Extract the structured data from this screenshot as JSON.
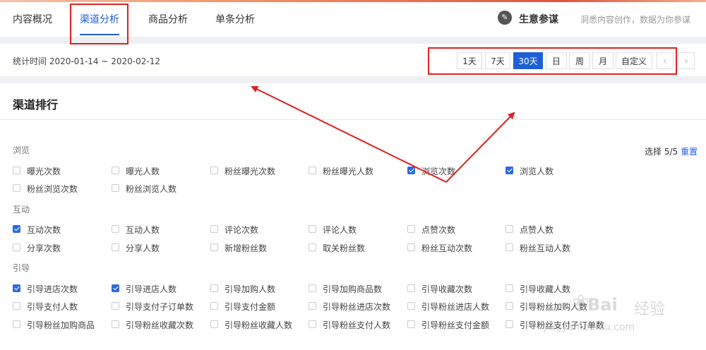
{
  "nav": {
    "tabs": [
      {
        "label": "内容概况"
      },
      {
        "label": "渠道分析"
      },
      {
        "label": "商品分析"
      },
      {
        "label": "单条分析"
      }
    ],
    "brand_name": "生意参谋",
    "brand_slogan": "洞悉内容创作，数据为你参谋"
  },
  "stats": {
    "time_text": "统计时间 2020-01-14 ~ 2020-02-12",
    "buttons": [
      {
        "label": "1天"
      },
      {
        "label": "7天"
      },
      {
        "label": "30天"
      },
      {
        "label": "日"
      },
      {
        "label": "周"
      },
      {
        "label": "月"
      },
      {
        "label": "自定义"
      },
      {
        "label": "‹"
      },
      {
        "label": "›"
      }
    ]
  },
  "ranking": {
    "title": "渠道排行",
    "select_text": "选择 5/5",
    "reset_label": "重置",
    "groups": [
      {
        "label": "浏览",
        "items": [
          {
            "label": "曝光次数",
            "checked": false
          },
          {
            "label": "曝光人数",
            "checked": false
          },
          {
            "label": "粉丝曝光次数",
            "checked": false
          },
          {
            "label": "粉丝曝光人数",
            "checked": false
          },
          {
            "label": "浏览次数",
            "checked": true
          },
          {
            "label": "浏览人数",
            "checked": true
          },
          {
            "label": "粉丝浏览次数",
            "checked": false
          },
          {
            "label": "粉丝浏览人数",
            "checked": false
          }
        ]
      },
      {
        "label": "互动",
        "items": [
          {
            "label": "互动次数",
            "checked": true
          },
          {
            "label": "互动人数",
            "checked": false
          },
          {
            "label": "评论次数",
            "checked": false
          },
          {
            "label": "评论人数",
            "checked": false
          },
          {
            "label": "点赞次数",
            "checked": false
          },
          {
            "label": "点赞人数",
            "checked": false
          },
          {
            "label": "分享次数",
            "checked": false
          },
          {
            "label": "分享人数",
            "checked": false
          },
          {
            "label": "新增粉丝数",
            "checked": false
          },
          {
            "label": "取关粉丝数",
            "checked": false
          },
          {
            "label": "粉丝互动次数",
            "checked": false
          },
          {
            "label": "粉丝互动人数",
            "checked": false
          }
        ]
      },
      {
        "label": "引导",
        "items": [
          {
            "label": "引导进店次数",
            "checked": true
          },
          {
            "label": "引导进店人数",
            "checked": true
          },
          {
            "label": "引导加购人数",
            "checked": false
          },
          {
            "label": "引导加购商品数",
            "checked": false
          },
          {
            "label": "引导收藏次数",
            "checked": false
          },
          {
            "label": "引导收藏人数",
            "checked": false
          },
          {
            "label": "引导支付人数",
            "checked": false
          },
          {
            "label": "引导支付子订单数",
            "checked": false
          },
          {
            "label": "引导支付金额",
            "checked": false
          },
          {
            "label": "引导粉丝进店次数",
            "checked": false
          },
          {
            "label": "引导粉丝进店人数",
            "checked": false
          },
          {
            "label": "引导粉丝加购人数",
            "checked": false
          },
          {
            "label": "引导粉丝加购商品",
            "checked": false
          },
          {
            "label": "引导粉丝收藏次数",
            "checked": false
          },
          {
            "label": "引导粉丝收藏人数",
            "checked": false
          },
          {
            "label": "引导粉丝支付人数",
            "checked": false
          },
          {
            "label": "引导粉丝支付金额",
            "checked": false
          },
          {
            "label": "引导粉丝支付子订单数",
            "checked": false
          }
        ]
      }
    ]
  },
  "watermark": {
    "brand": "Bai",
    "brand_cn": "经验",
    "url": "jingyan.baidu.com"
  },
  "colors": {
    "accent": "#1f5fd6",
    "highlight": "#e02020"
  }
}
